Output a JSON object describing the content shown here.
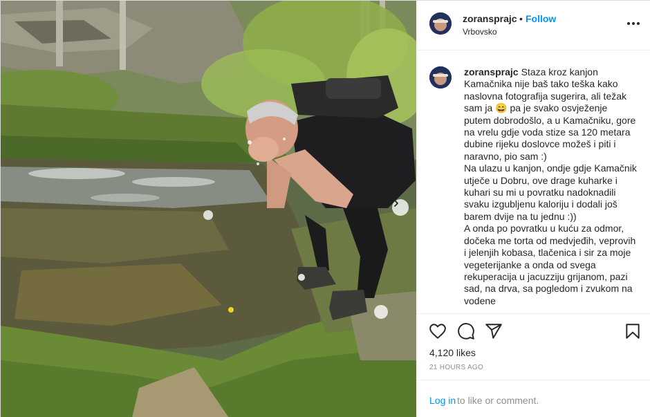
{
  "post": {
    "username": "zoransprajc",
    "follow_label": "Follow",
    "dot": "•",
    "location": "Vrbovsko",
    "caption_username": "zoransprajc",
    "caption_text": "Staza kroz kanjon Kamačnika nije baš tako teška kako naslovna fotografija sugerira, ali težak sam ja 😄 pa je svako osvježenje putem dobrodošlo, a u Kamačniku, gore na vrelu gdje voda stize sa 120 metara dubine rijeku doslovce možeš i piti i naravno, pio sam :)\nNa ulazu u kanjon, ondje gdje Kamačnik utječe u Dobru, ove drage kuharke i kuhari su mi u povratku nadoknadili svaku izgubljenu kaloriju i dodali još barem dvije na tu jednu :))\nA onda po povratku u kuću za odmor, dočeka me torta od medvjeđih, veprovih i jelenjih kobasa, tlačenica i sir za moje vegeterijanke a onda od svega rekuperacija u jacuzziju grijanom, pazi sad, na drva, sa pogledom i zvukom na vodene",
    "likes": "4,120 likes",
    "time_ago": "21 HOURS AGO",
    "login_link": "Log in",
    "login_rest": "to like or comment."
  },
  "icons": {
    "more": "more-options-icon",
    "like": "heart-icon",
    "comment": "comment-icon",
    "share": "share-icon",
    "save": "bookmark-icon",
    "next": "chevron-right-icon"
  },
  "colors": {
    "accent": "#0095f6",
    "text": "#262626",
    "muted": "#8e8e8e",
    "border": "#efefef"
  }
}
